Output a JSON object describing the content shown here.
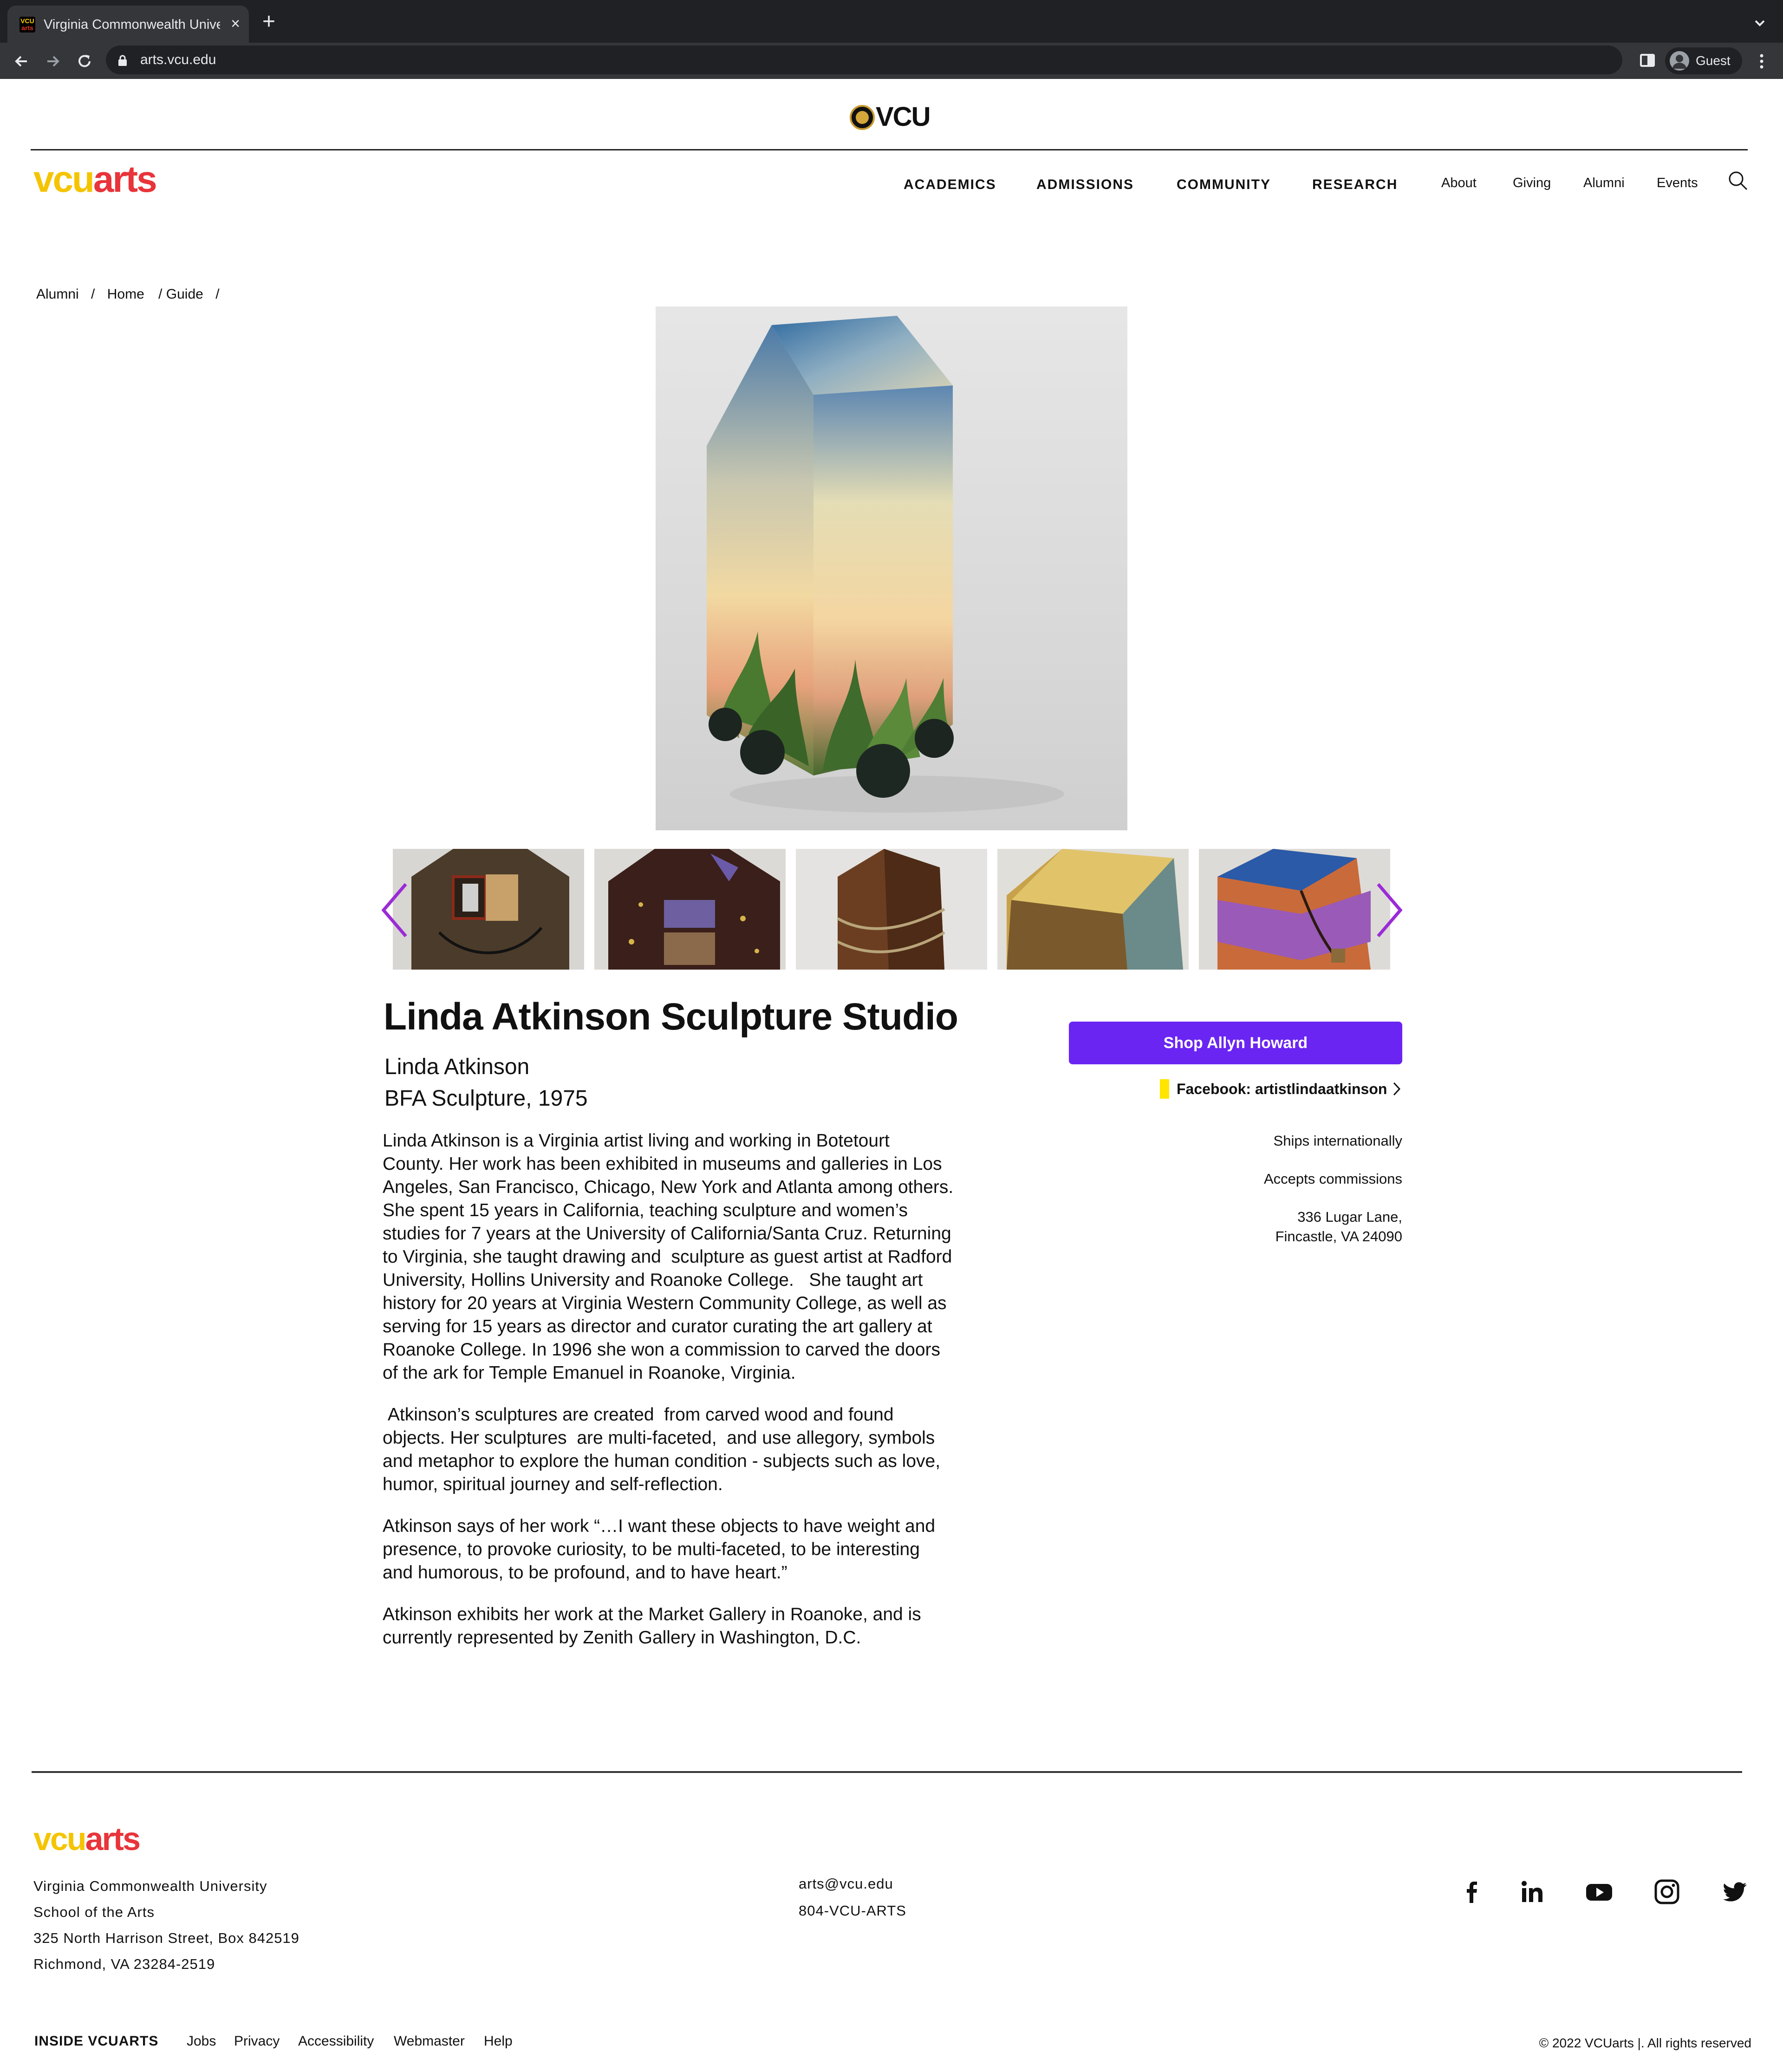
{
  "browser": {
    "tab_title": "Virginia Commonwealth University",
    "favicon": {
      "top": "VCU",
      "bottom": "arts"
    },
    "url": "arts.vcu.edu",
    "profile_label": "Guest"
  },
  "header": {
    "top_logo": "VCU",
    "brand": {
      "part1": "vcu",
      "part2": "arts"
    },
    "main_nav": [
      "ACADEMICS",
      "ADMISSIONS",
      "COMMUNITY",
      "RESEARCH"
    ],
    "utility_nav": [
      "About",
      "Giving",
      "Alumni",
      "Events"
    ]
  },
  "breadcrumb": [
    "Alumni",
    "/",
    "Home",
    "/ Guide",
    "/"
  ],
  "gallery": {
    "hero_icon": "painted-house-sculpture",
    "thumbnails": [
      "sculpture-1",
      "sculpture-2",
      "sculpture-3",
      "sculpture-4",
      "sculpture-5"
    ],
    "accent_color": "#9b2bd6"
  },
  "profile": {
    "studio_name": "Linda Atkinson Sculpture Studio",
    "artist_name": "Linda Atkinson",
    "degree": "BFA Sculpture, 1975",
    "bio": [
      "Linda Atkinson is a Virginia artist living and working in Botetourt County. Her work has been exhibited in museums and galleries in Los Angeles, San Francisco, Chicago, New York and Atlanta among others.  She spent 15 years in California, teaching sculpture and women’s studies for 7 years at the University of California/Santa Cruz. Returning to Virginia, she taught drawing and  sculpture as guest artist at Radford University, Hollins University and Roanoke College.   She taught art history for 20 years at Virginia Western Community College, as well as serving for 15 years as director and curator curating the art gallery at Roanoke College. In 1996 she won a commission to carved the doors of the ark for Temple Emanuel in Roanoke, Virginia.",
      " Atkinson’s sculptures are created  from carved wood and found objects. Her sculptures  are multi-faceted,  and use allegory, symbols and metaphor to explore the human condition - subjects such as love, humor, spiritual journey and self-reflection.",
      "Atkinson says of her work “…I want these objects to have weight and presence, to provoke curiosity, to be multi-faceted, to be interesting and humorous, to be profound, and to have heart.”",
      "Atkinson exhibits her work at the Market Gallery in Roanoke, and is currently represented by Zenith Gallery in Washington, D.C."
    ],
    "shop_label": "Shop Allyn Howard",
    "shop_color": "#6a25f3",
    "facebook_label": "Facebook: artistlindaatkinson",
    "ships": "Ships internationally",
    "commissions": "Accepts commissions",
    "address_line1": "336 Lugar Lane,",
    "address_line2": "Fincastle, VA  24090"
  },
  "footer": {
    "brand": {
      "part1": "vcu",
      "part2": "arts"
    },
    "address": [
      "Virginia Commonwealth University",
      "School of the Arts",
      "325 North Harrison Street, Box 842519",
      "Richmond, VA 23284-2519"
    ],
    "email": "arts@vcu.edu",
    "phone": "804-VCU-ARTS",
    "social": [
      "facebook-icon",
      "linkedin-icon",
      "youtube-icon",
      "instagram-icon",
      "twitter-icon"
    ],
    "nav": {
      "inside": "INSIDE VCUARTS",
      "links": [
        "Jobs",
        "Privacy",
        "Accessibility",
        "Webmaster",
        "Help"
      ]
    },
    "copyright": "© 2022 VCUarts    |.  All rights reserved"
  }
}
